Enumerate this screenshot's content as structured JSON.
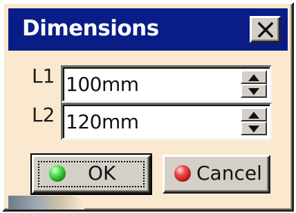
{
  "window": {
    "title": "Dimensions",
    "close_glyph": "X",
    "colors": {
      "titlebar": "#0a1d87",
      "body": "#fae9cf",
      "button_face": "#d4d0c8"
    }
  },
  "fields": [
    {
      "label": "L1",
      "value": "100mm"
    },
    {
      "label": "L2",
      "value": "120mm"
    }
  ],
  "buttons": {
    "ok_label": "OK",
    "ok_icon": "green-light-icon",
    "cancel_label": "Cancel",
    "cancel_icon": "red-light-icon"
  }
}
